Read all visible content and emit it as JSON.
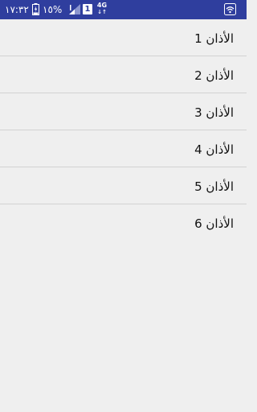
{
  "status_bar": {
    "time": "١٧:٣٢",
    "battery_percent": "١٥%",
    "sim_slot": "1",
    "network_type": "4G",
    "network_arrows": "↓↑",
    "background_color": "#2f3e9e"
  },
  "list": {
    "items": [
      {
        "label": "الأذان 1"
      },
      {
        "label": "الأذان 2"
      },
      {
        "label": "الأذان 3"
      },
      {
        "label": "الأذان 4"
      },
      {
        "label": "الأذان 5"
      },
      {
        "label": "الأذان 6"
      }
    ]
  }
}
